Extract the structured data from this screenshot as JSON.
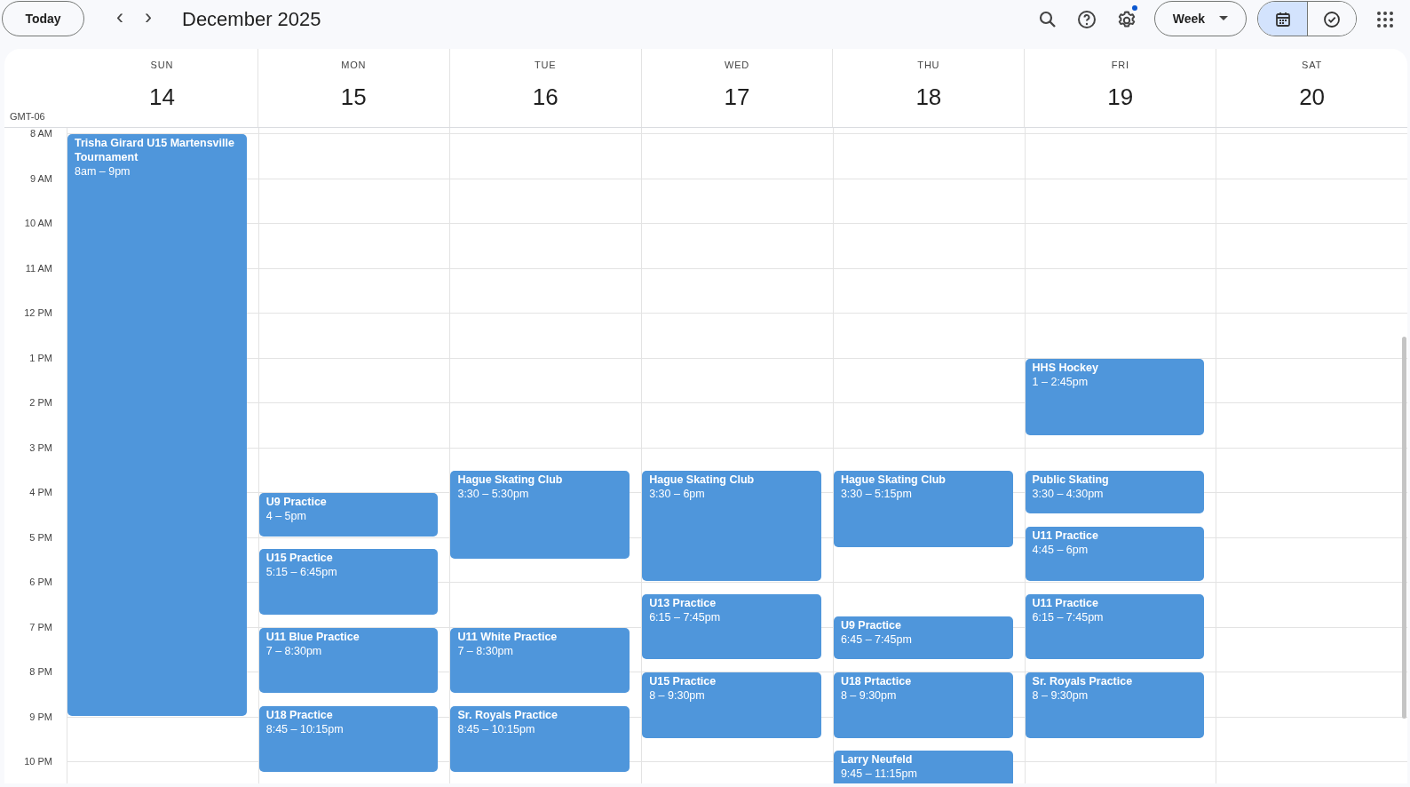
{
  "toolbar": {
    "today_button": "Today",
    "prev_icon": "‹",
    "next_icon": "›",
    "title": "December 2025",
    "view_select": "Week",
    "settings_notification": true,
    "view_toggle": [
      {
        "kind": "calendar",
        "selected": true
      },
      {
        "kind": "tasks",
        "selected": false
      }
    ]
  },
  "timezone": "GMT-06",
  "hours": [
    "8 AM",
    "9 AM",
    "10 AM",
    "11 AM",
    "12 PM",
    "1 PM",
    "2 PM",
    "3 PM",
    "4 PM",
    "5 PM",
    "6 PM",
    "7 PM",
    "8 PM",
    "9 PM",
    "10 PM"
  ],
  "days": [
    {
      "weekday": "SUN",
      "date": "14",
      "events": [
        {
          "title": "Trisha Girard U15 Martensville Tournament",
          "time": "8am – 9pm"
        }
      ]
    },
    {
      "weekday": "MON",
      "date": "15",
      "events": [
        {
          "title": "U9 Practice",
          "time": "4 – 5pm"
        },
        {
          "title": "U15 Practice",
          "time": "5:15 – 6:45pm"
        },
        {
          "title": "U11 Blue Practice",
          "time": "7 – 8:30pm"
        },
        {
          "title": "U18 Practice",
          "time": "8:45 – 10:15pm"
        }
      ]
    },
    {
      "weekday": "TUE",
      "date": "16",
      "events": [
        {
          "title": "Hague Skating Club",
          "time": "3:30 – 5:30pm"
        },
        {
          "title": "U11 White Practice",
          "time": "7 – 8:30pm"
        },
        {
          "title": "Sr. Royals Practice",
          "time": "8:45 – 10:15pm"
        }
      ]
    },
    {
      "weekday": "WED",
      "date": "17",
      "events": [
        {
          "title": "Hague Skating Club",
          "time": "3:30 – 6pm"
        },
        {
          "title": "U13 Practice",
          "time": "6:15 – 7:45pm"
        },
        {
          "title": "U15 Practice",
          "time": "8 – 9:30pm"
        }
      ]
    },
    {
      "weekday": "THU",
      "date": "18",
      "events": [
        {
          "title": "Hague Skating Club",
          "time": "3:30 – 5:15pm"
        },
        {
          "title": "U9 Practice",
          "time": "6:45 – 7:45pm"
        },
        {
          "title": "U18 Prtactice",
          "time": "8 – 9:30pm"
        },
        {
          "title": "Larry Neufeld",
          "time": "9:45 – 11:15pm"
        }
      ]
    },
    {
      "weekday": "FRI",
      "date": "19",
      "events": [
        {
          "title": "HHS Hockey",
          "time": "1 – 2:45pm"
        },
        {
          "title": "Public Skating",
          "time": "3:30 – 4:30pm"
        },
        {
          "title": "U11 Practice",
          "time": "4:45 – 6pm"
        },
        {
          "title": "U11 Practice",
          "time": "6:15 – 7:45pm"
        },
        {
          "title": "Sr. Royals Practice",
          "time": "8 – 9:30pm"
        }
      ]
    },
    {
      "weekday": "SAT",
      "date": "20"
    }
  ]
}
